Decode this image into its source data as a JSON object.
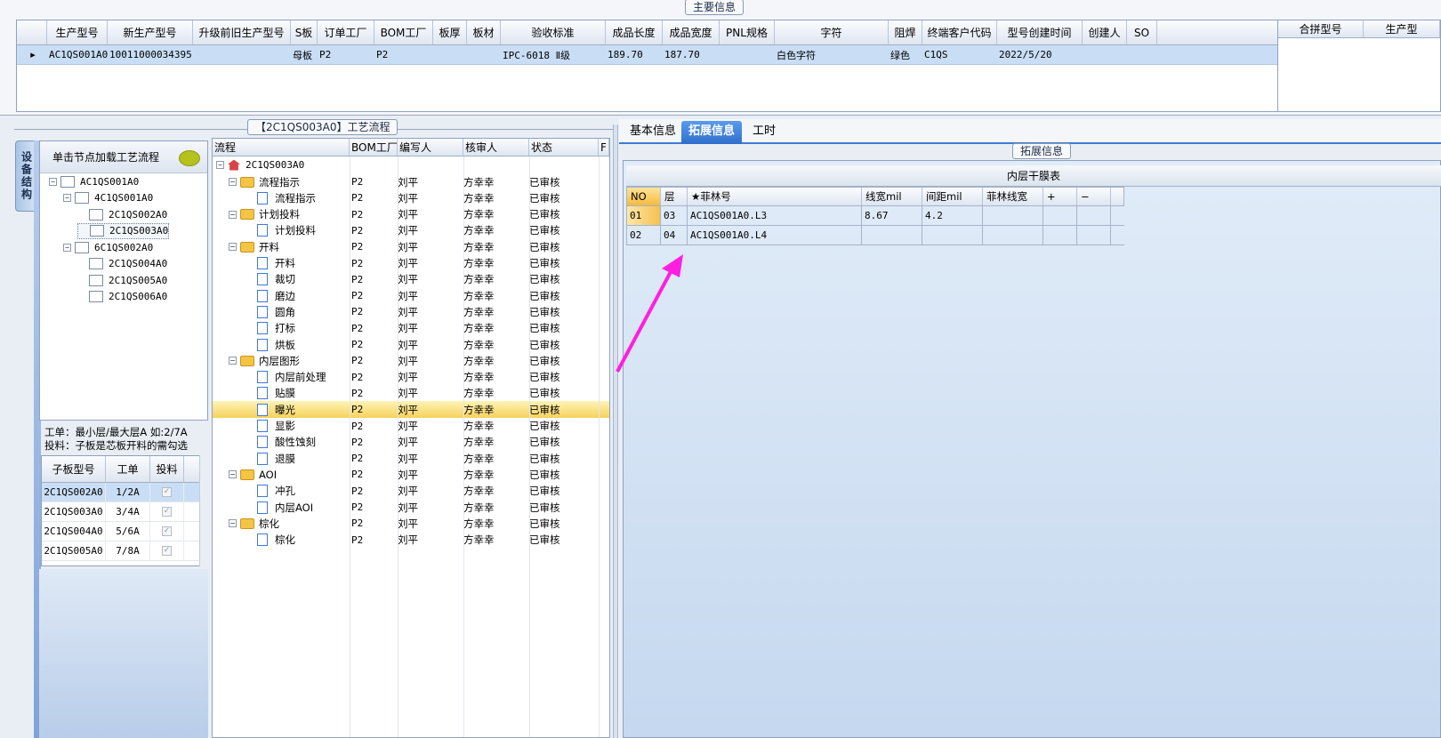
{
  "main_info": {
    "title": "主要信息",
    "columns": [
      "生产型号",
      "新生产型号",
      "升级前旧生产型号",
      "S板",
      "订单工厂",
      "BOM工厂",
      "板厚",
      "板材",
      "验收标准",
      "成品长度",
      "成品宽度",
      "PNL规格",
      "字符",
      "阻焊",
      "终端客户代码",
      "型号创建时间",
      "创建人",
      "SO"
    ],
    "row": [
      "AC1QS001A0",
      "10011000034395",
      "",
      "母板",
      "P2",
      "P2",
      "",
      "",
      "IPC-6018 Ⅱ级",
      "189.70",
      "187.70",
      "",
      "白色字符",
      "绿色",
      "C1QS",
      "2022/5/20",
      "",
      ""
    ],
    "row_indicator": "▸",
    "merge_columns": [
      "合拼型号",
      "生产型"
    ]
  },
  "device_structure": {
    "tab_label": "设备结构",
    "load_button": "单击节点加载工艺流程",
    "tree": [
      {
        "label": "AC1QS001A0",
        "level": 0,
        "expander": "−"
      },
      {
        "label": "4C1QS001A0",
        "level": 1,
        "expander": "−"
      },
      {
        "label": "2C1QS002A0",
        "level": 2,
        "expander": ""
      },
      {
        "label": "2C1QS003A0",
        "level": 2,
        "expander": "",
        "selected": true
      },
      {
        "label": "6C1QS002A0",
        "level": 1,
        "expander": "−"
      },
      {
        "label": "2C1QS004A0",
        "level": 2,
        "expander": ""
      },
      {
        "label": "2C1QS005A0",
        "level": 2,
        "expander": ""
      },
      {
        "label": "2C1QS006A0",
        "level": 2,
        "expander": ""
      }
    ],
    "hint_line1": "工单：最小层/最大层A 如:2/7A",
    "hint_line2": "投料：子板是芯板开料的需勾选",
    "sub_columns": [
      "子板型号",
      "工单",
      "投料"
    ],
    "sub_rows": [
      [
        "2C1QS002A0",
        "1/2A",
        "✓"
      ],
      [
        "2C1QS003A0",
        "3/4A",
        "✓"
      ],
      [
        "2C1QS004A0",
        "5/6A",
        "✓"
      ],
      [
        "2C1QS005A0",
        "7/8A",
        "✓"
      ]
    ]
  },
  "process_flow": {
    "title": "【2C1QS003A0】工艺流程",
    "columns": [
      "流程",
      "BOM工厂",
      "编写人",
      "核审人",
      "状态",
      "F"
    ],
    "root": "2C1QS003A0",
    "rows": [
      {
        "name": "流程指示",
        "type": "folder",
        "bom": "P2",
        "writer": "刘平",
        "auditor": "方幸幸",
        "status": "已审核"
      },
      {
        "name": "流程指示",
        "type": "doc",
        "bom": "P2",
        "writer": "刘平",
        "auditor": "方幸幸",
        "status": "已审核"
      },
      {
        "name": "计划投料",
        "type": "folder",
        "bom": "P2",
        "writer": "刘平",
        "auditor": "方幸幸",
        "status": "已审核"
      },
      {
        "name": "计划投料",
        "type": "doc",
        "bom": "P2",
        "writer": "刘平",
        "auditor": "方幸幸",
        "status": "已审核"
      },
      {
        "name": "开料",
        "type": "folder",
        "bom": "P2",
        "writer": "刘平",
        "auditor": "方幸幸",
        "status": "已审核"
      },
      {
        "name": "开料",
        "type": "doc",
        "bom": "P2",
        "writer": "刘平",
        "auditor": "方幸幸",
        "status": "已审核"
      },
      {
        "name": "裁切",
        "type": "doc",
        "bom": "P2",
        "writer": "刘平",
        "auditor": "方幸幸",
        "status": "已审核"
      },
      {
        "name": "磨边",
        "type": "doc",
        "bom": "P2",
        "writer": "刘平",
        "auditor": "方幸幸",
        "status": "已审核"
      },
      {
        "name": "圆角",
        "type": "doc",
        "bom": "P2",
        "writer": "刘平",
        "auditor": "方幸幸",
        "status": "已审核"
      },
      {
        "name": "打标",
        "type": "doc",
        "bom": "P2",
        "writer": "刘平",
        "auditor": "方幸幸",
        "status": "已审核"
      },
      {
        "name": "烘板",
        "type": "doc",
        "bom": "P2",
        "writer": "刘平",
        "auditor": "方幸幸",
        "status": "已审核"
      },
      {
        "name": "内层图形",
        "type": "folder",
        "bom": "P2",
        "writer": "刘平",
        "auditor": "方幸幸",
        "status": "已审核"
      },
      {
        "name": "内层前处理",
        "type": "doc",
        "bom": "P2",
        "writer": "刘平",
        "auditor": "方幸幸",
        "status": "已审核"
      },
      {
        "name": "贴膜",
        "type": "doc",
        "bom": "P2",
        "writer": "刘平",
        "auditor": "方幸幸",
        "status": "已审核"
      },
      {
        "name": "曝光",
        "type": "doc",
        "bom": "P2",
        "writer": "刘平",
        "auditor": "方幸幸",
        "status": "已审核",
        "selected": true
      },
      {
        "name": "显影",
        "type": "doc",
        "bom": "P2",
        "writer": "刘平",
        "auditor": "方幸幸",
        "status": "已审核"
      },
      {
        "name": "酸性蚀刻",
        "type": "doc",
        "bom": "P2",
        "writer": "刘平",
        "auditor": "方幸幸",
        "status": "已审核"
      },
      {
        "name": "退膜",
        "type": "doc",
        "bom": "P2",
        "writer": "刘平",
        "auditor": "方幸幸",
        "status": "已审核"
      },
      {
        "name": "AOI",
        "type": "folder",
        "bom": "P2",
        "writer": "刘平",
        "auditor": "方幸幸",
        "status": "已审核"
      },
      {
        "name": "冲孔",
        "type": "doc",
        "bom": "P2",
        "writer": "刘平",
        "auditor": "方幸幸",
        "status": "已审核"
      },
      {
        "name": "内层AOI",
        "type": "doc",
        "bom": "P2",
        "writer": "刘平",
        "auditor": "方幸幸",
        "status": "已审核"
      },
      {
        "name": "棕化",
        "type": "folder",
        "bom": "P2",
        "writer": "刘平",
        "auditor": "方幸幸",
        "status": "已审核"
      },
      {
        "name": "棕化",
        "type": "doc",
        "bom": "P2",
        "writer": "刘平",
        "auditor": "方幸幸",
        "status": "已审核"
      }
    ]
  },
  "right_panel": {
    "tabs": [
      "基本信息",
      "拓展信息",
      "工时"
    ],
    "active_tab": 1,
    "group_title": "拓展信息",
    "table_title": "内层干膜表",
    "columns": [
      "NO",
      "层",
      "★菲林号",
      "线宽mil",
      "间距mil",
      "菲林线宽",
      "+",
      "−"
    ],
    "rows": [
      [
        "01",
        "03",
        "AC1QS001A0.L3",
        "8.67",
        "4.2",
        "",
        "",
        ""
      ],
      [
        "02",
        "04",
        "AC1QS001A0.L4",
        "",
        "",
        "",
        "",
        ""
      ]
    ]
  },
  "colors": {
    "selection": "#c9def5",
    "accent": "#2f6fcc",
    "arrow": "#ff1fe0",
    "highlight_row": "#f6d25e"
  }
}
